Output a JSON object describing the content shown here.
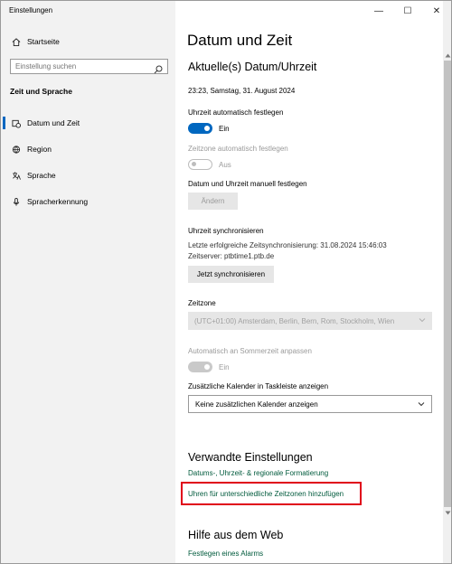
{
  "window": {
    "title": "Einstellungen",
    "controls": {
      "minimize": "—",
      "maximize": "☐",
      "close": "✕"
    }
  },
  "sidebar": {
    "home": {
      "label": "Startseite",
      "icon": "home-icon"
    },
    "search": {
      "placeholder": "Einstellung suchen",
      "icon": "search-icon"
    },
    "section_heading": "Zeit und Sprache",
    "items": [
      {
        "label": "Datum und Zeit",
        "icon": "clock-calendar-icon",
        "active": true
      },
      {
        "label": "Region",
        "icon": "globe-icon",
        "active": false
      },
      {
        "label": "Sprache",
        "icon": "language-icon",
        "active": false
      },
      {
        "label": "Spracherkennung",
        "icon": "microphone-icon",
        "active": false
      }
    ]
  },
  "main": {
    "page_title": "Datum und Zeit",
    "current_heading": "Aktuelle(s) Datum/Uhrzeit",
    "current_datetime": "23:23, Samstag, 31. August 2024",
    "auto_time": {
      "label": "Uhrzeit automatisch festlegen",
      "state": "Ein"
    },
    "auto_timezone": {
      "label": "Zeitzone automatisch festlegen",
      "state": "Aus"
    },
    "manual": {
      "label": "Datum und Uhrzeit manuell festlegen",
      "button": "Ändern"
    },
    "sync": {
      "heading": "Uhrzeit synchronisieren",
      "last_sync": "Letzte erfolgreiche Zeitsynchronisierung: 31.08.2024 15:46:03",
      "server": "Zeitserver: ptbtime1.ptb.de",
      "button": "Jetzt synchronisieren"
    },
    "timezone": {
      "heading": "Zeitzone",
      "value": "(UTC+01:00) Amsterdam, Berlin, Bern, Rom, Stockholm, Wien"
    },
    "dst": {
      "label": "Automatisch an Sommerzeit anpassen",
      "state": "Ein"
    },
    "calendar": {
      "label": "Zusätzliche Kalender in Taskleiste anzeigen",
      "value": "Keine zusätzlichen Kalender anzeigen"
    },
    "related": {
      "heading": "Verwandte Einstellungen",
      "link1": "Datums-, Uhrzeit- & regionale Formatierung",
      "link2": "Uhren für unterschiedliche Zeitzonen hinzufügen"
    },
    "help": {
      "heading": "Hilfe aus dem Web",
      "link1": "Festlegen eines Alarms"
    }
  },
  "colors": {
    "accent": "#0067c0",
    "link": "#005a3c",
    "highlight": "#e0001a"
  }
}
